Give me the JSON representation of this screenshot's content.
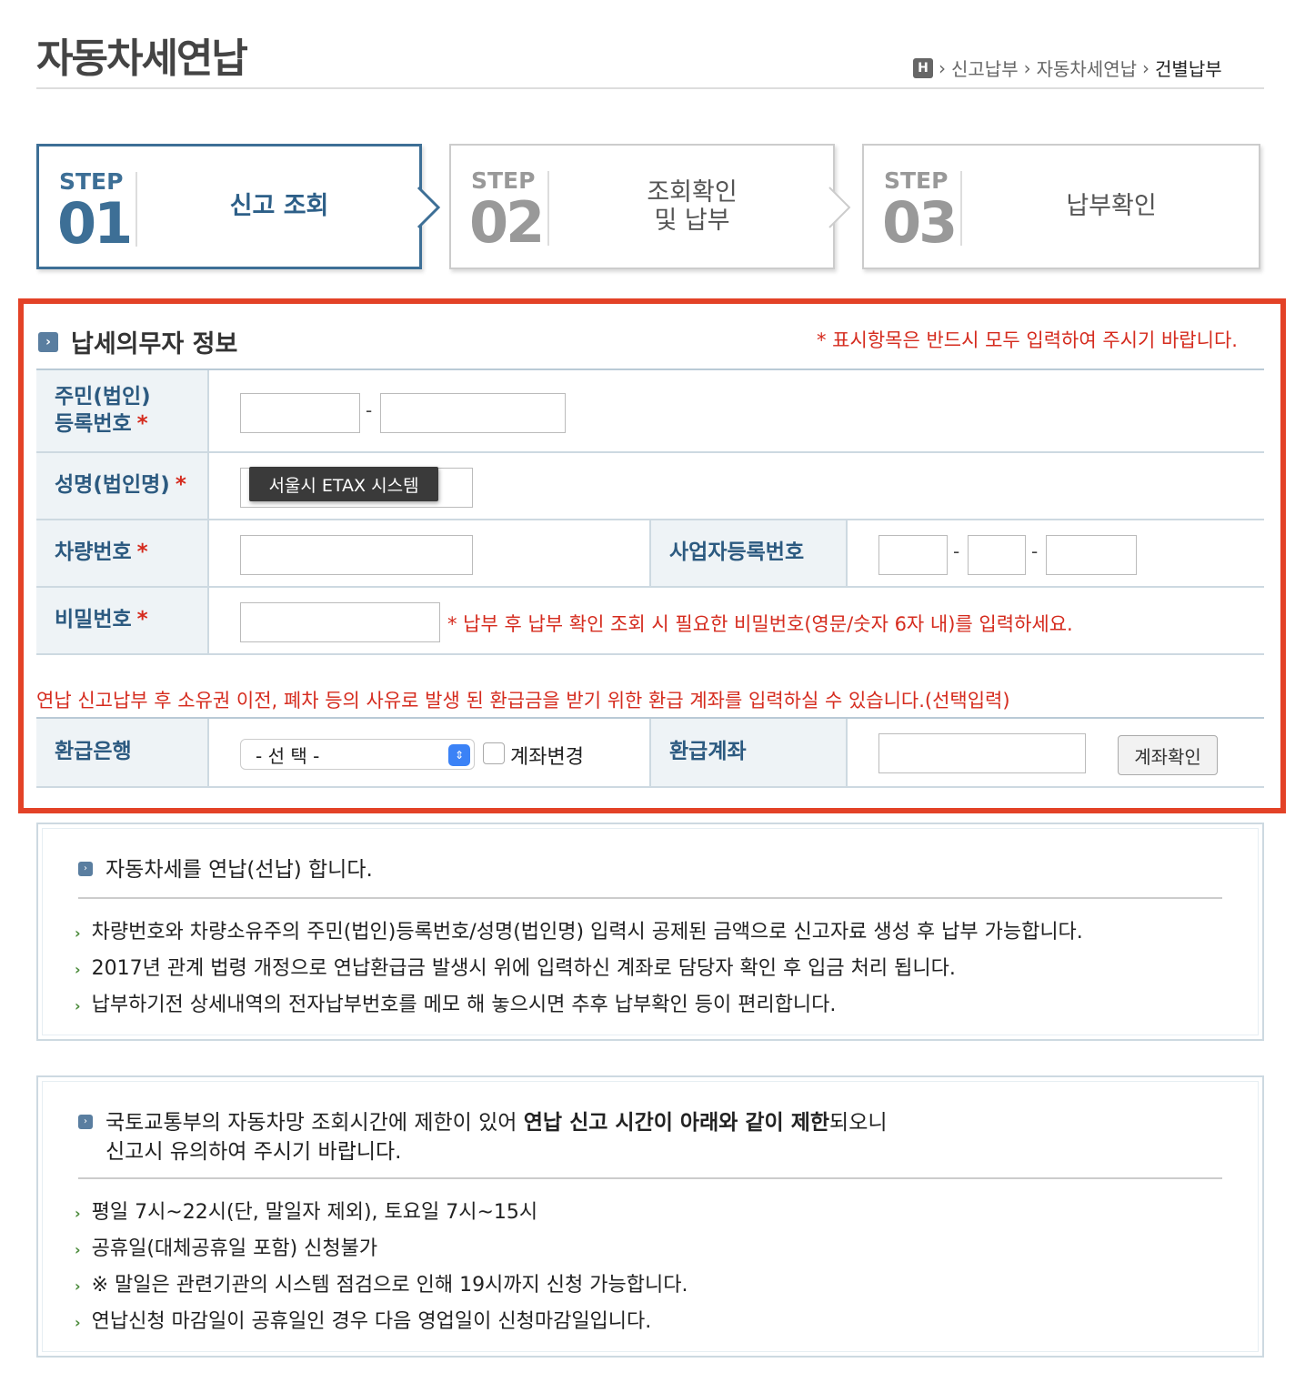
{
  "title": "자동차세연납",
  "breadcrumb": {
    "home": "H",
    "items": [
      "신고납부",
      "자동차세연납"
    ],
    "current": "건별납부"
  },
  "steps": [
    {
      "label": "STEP",
      "num": "01",
      "text": "신고 조회",
      "active": true
    },
    {
      "label": "STEP",
      "num": "02",
      "text_l1": "조회확인",
      "text_l2": "및 납부",
      "active": false
    },
    {
      "label": "STEP",
      "num": "03",
      "text": "납부확인",
      "active": false
    }
  ],
  "section": {
    "title": "납세의무자 정보",
    "required_note": "* 표시항목은 반드시 모두 입력하여 주시기 바랍니다.",
    "rrn_label_l1": "주민(법인)",
    "rrn_label_l2": "등록번호",
    "name_label": "성명(법인명)",
    "tooltip": "서울시 ETAX 시스템",
    "car_label": "차량번호",
    "biz_label": "사업자등록번호",
    "pw_label": "비밀번호",
    "pw_note": "* 납부 후 납부 확인 조회 시 필요한 비밀번호(영문/숫자 6자 내)를 입력하세요.",
    "star": "*",
    "dash": "-",
    "refund_note": "연납 신고납부 후 소유권 이전, 폐차 등의 사유로 발생 된 환급금을 받기 위한 환급 계좌를 입력하실 수 있습니다.(선택입력)",
    "bank_label": "환급은행",
    "bank_select": "- 선 택 -",
    "account_change": "계좌변경",
    "account_label": "환급계좌",
    "account_button": "계좌확인"
  },
  "info1": {
    "heading": "자동차세를 연납(선납) 합니다.",
    "bullets": [
      "차량번호와 차량소유주의 주민(법인)등록번호/성명(법인명) 입력시 공제된 금액으로 신고자료 생성 후 납부 가능합니다.",
      "2017년 관계 법령 개정으로 연납환급금 발생시 위에 입력하신 계좌로 담당자 확인 후 입금 처리 됩니다.",
      "납부하기전 상세내역의 전자납부번호를 메모 해 놓으시면 추후 납부확인 등이 편리합니다."
    ]
  },
  "info2": {
    "heading_pre": "국토교통부의 자동차망 조회시간에 제한이 있어 ",
    "heading_bold": "연납 신고 시간이 아래와 같이 제한",
    "heading_post": "되오니",
    "heading_l2": "신고시 유의하여 주시기 바랍니다.",
    "bullets": [
      "평일 7시~22시(단, 말일자 제외), 토요일 7시~15시",
      "공휴일(대체공휴일 포함) 신청불가",
      "※ 말일은 관련기관의 시스템 점검으로 인해 19시까지 신청 가능합니다.",
      "연납신청 마감일이 공휴일인 경우 다음 영업일이 신청마감일입니다."
    ]
  }
}
